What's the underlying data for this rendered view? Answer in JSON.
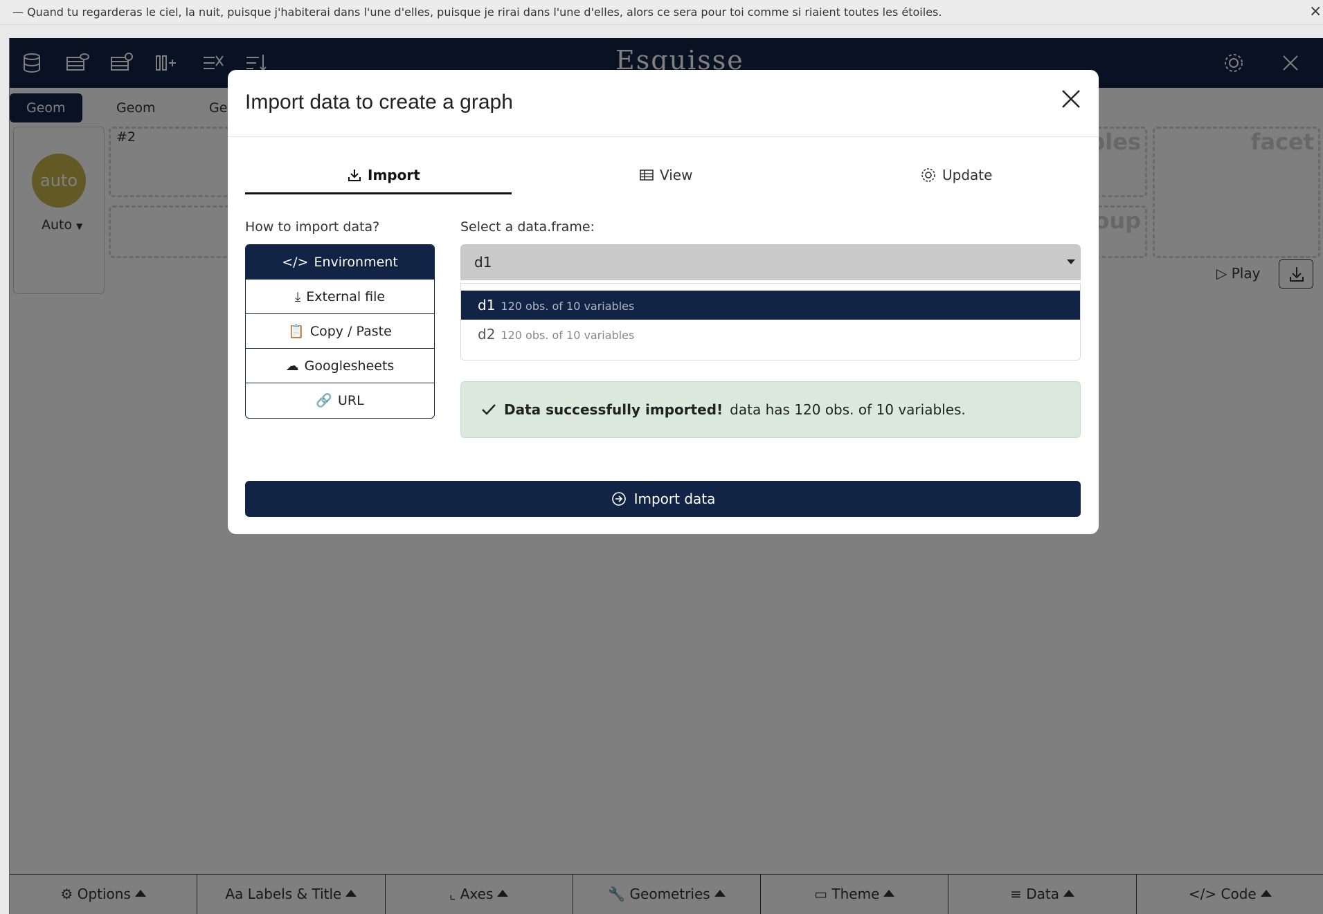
{
  "notice": {
    "text": "— Quand tu regarderas le ciel, la nuit, puisque j'habiterai dans l'une d'elles, puisque je rirai dans l'une d'elles, alors ce sera pour toi comme si riaient toutes les étoiles.",
    "close": "×"
  },
  "app": {
    "title": "Esquisse",
    "header_icons": [
      "database-icon",
      "table-view-icon",
      "table-settings-icon",
      "add-column-icon",
      "mutate-icon",
      "sort-icon"
    ],
    "geom_tabs": [
      "Geom #1",
      "Geom #2",
      "Ge"
    ],
    "aes": {
      "circle_text": "auto",
      "label": "Auto"
    },
    "zones": {
      "vars": "bles",
      "facet": "facet",
      "group": "oup"
    },
    "play_label": "Play",
    "bottom_bar": [
      "Options",
      "Aa Labels & Title",
      "Axes",
      "Geometries",
      "Theme",
      "Data",
      "</> Code"
    ]
  },
  "modal": {
    "title": "Import data to create a graph",
    "tabs": [
      "Import",
      "View",
      "Update"
    ],
    "how_label": "How to import data?",
    "methods": [
      "Environment",
      "External file",
      "Copy / Paste",
      "Googlesheets",
      "URL"
    ],
    "select_label": "Select a data.frame:",
    "selected_value": "d1",
    "options": [
      {
        "name": "d1",
        "desc": "120 obs. of 10 variables"
      },
      {
        "name": "d2",
        "desc": "120 obs. of 10 variables"
      }
    ],
    "alert_bold": "Data successfully imported!",
    "alert_text": "data has 120 obs. of 10 variables.",
    "import_button": "Import data"
  },
  "colors": {
    "navy": "#112446",
    "success_bg": "#dbe9dd",
    "auto_circle": "#c4b24a"
  }
}
